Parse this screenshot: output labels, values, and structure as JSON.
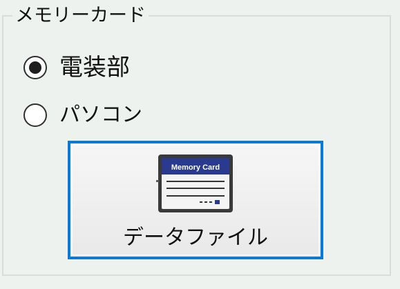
{
  "groupbox": {
    "title": "メモリーカード"
  },
  "radios": [
    {
      "label": "電装部",
      "selected": true
    },
    {
      "label": "パソコン",
      "selected": false
    }
  ],
  "button": {
    "label": "データファイル",
    "icon": "memory-card-icon",
    "card_text": "Memory Card"
  },
  "colors": {
    "accent": "#0b79d6",
    "background": "#eef2ef",
    "card_header": "#2a3b8f"
  }
}
